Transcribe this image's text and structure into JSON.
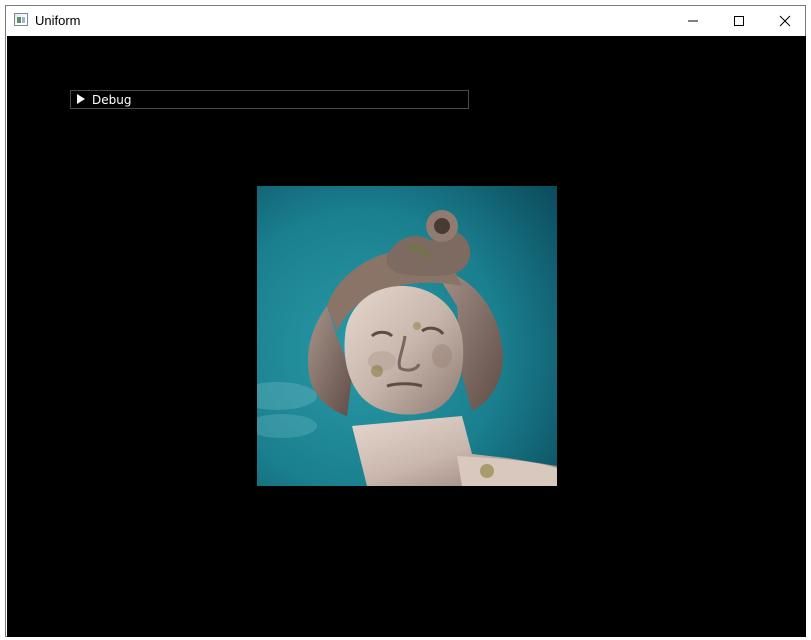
{
  "window": {
    "title": "Uniform",
    "icon": "app-window-icon",
    "controls": {
      "minimize_icon": "minimize-icon",
      "maximize_icon": "maximize-icon",
      "close_icon": "close-icon"
    }
  },
  "debug_panel": {
    "label": "Debug",
    "expanded": false,
    "arrow_icon": "triangle-right-icon"
  },
  "image": {
    "subject": "statue-head-photo",
    "colors": {
      "sky": "#1a7f8e",
      "sky_dark": "#0b4a5c",
      "stone": "#c9b7ad"
    }
  },
  "colors": {
    "canvas_background": "#000000",
    "titlebar_background": "#ffffff",
    "panel_border": "#4a4a4a"
  }
}
